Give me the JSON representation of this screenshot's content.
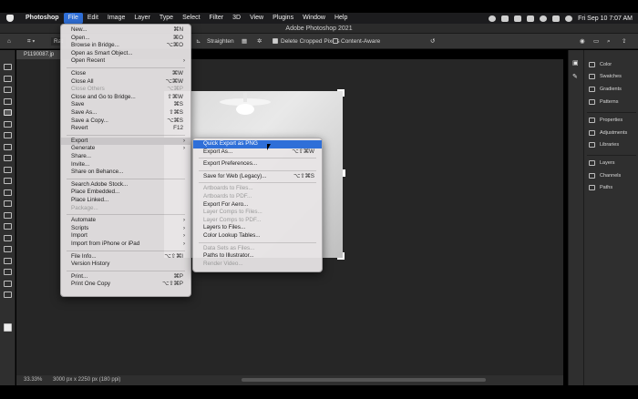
{
  "menubar": {
    "app": "Photoshop",
    "items": [
      "File",
      "Edit",
      "Image",
      "Layer",
      "Type",
      "Select",
      "Filter",
      "3D",
      "View",
      "Plugins",
      "Window",
      "Help"
    ],
    "active": "File",
    "clock": "Fri Sep 10  7:07 AM"
  },
  "window": {
    "title": "Adobe Photoshop 2021"
  },
  "options": {
    "ratio_label": "Rat",
    "straighten": "Straighten",
    "delete_cropped": "Delete Cropped Pixels",
    "content_aware": "Content-Aware"
  },
  "document": {
    "tab": "P1190087.jp"
  },
  "status": {
    "zoom": "33.33%",
    "dimensions": "3000 px x 2250 px (180 ppi)"
  },
  "right_panel": {
    "items": [
      "Color",
      "Swatches",
      "Gradients",
      "Patterns",
      "Properties",
      "Adjustments",
      "Libraries",
      "Layers",
      "Channels",
      "Paths"
    ]
  },
  "file_menu": {
    "rows": [
      {
        "label": "New...",
        "shortcut": "⌘N"
      },
      {
        "label": "Open...",
        "shortcut": "⌘O"
      },
      {
        "label": "Browse in Bridge...",
        "shortcut": "⌥⌘O"
      },
      {
        "label": "Open as Smart Object...",
        "shortcut": ""
      },
      {
        "label": "Open Recent",
        "shortcut": "",
        "submenu": true
      },
      {
        "sep": true
      },
      {
        "label": "Close",
        "shortcut": "⌘W"
      },
      {
        "label": "Close All",
        "shortcut": "⌥⌘W"
      },
      {
        "label": "Close Others",
        "shortcut": "⌥⌘P",
        "disabled": true
      },
      {
        "label": "Close and Go to Bridge...",
        "shortcut": "⇧⌘W"
      },
      {
        "label": "Save",
        "shortcut": "⌘S"
      },
      {
        "label": "Save As...",
        "shortcut": "⇧⌘S"
      },
      {
        "label": "Save a Copy...",
        "shortcut": "⌥⌘S"
      },
      {
        "label": "Revert",
        "shortcut": "F12"
      },
      {
        "sep": true
      },
      {
        "label": "Export",
        "shortcut": "",
        "submenu": true,
        "highlight": true
      },
      {
        "label": "Generate",
        "shortcut": "",
        "submenu": true
      },
      {
        "label": "Share...",
        "shortcut": ""
      },
      {
        "label": "Invite...",
        "shortcut": ""
      },
      {
        "label": "Share on Behance...",
        "shortcut": ""
      },
      {
        "sep": true
      },
      {
        "label": "Search Adobe Stock...",
        "shortcut": ""
      },
      {
        "label": "Place Embedded...",
        "shortcut": ""
      },
      {
        "label": "Place Linked...",
        "shortcut": ""
      },
      {
        "label": "Package...",
        "shortcut": "",
        "disabled": true
      },
      {
        "sep": true
      },
      {
        "label": "Automate",
        "shortcut": "",
        "submenu": true
      },
      {
        "label": "Scripts",
        "shortcut": "",
        "submenu": true
      },
      {
        "label": "Import",
        "shortcut": "",
        "submenu": true
      },
      {
        "label": "Import from iPhone or iPad",
        "shortcut": "",
        "submenu": true
      },
      {
        "sep": true
      },
      {
        "label": "File Info...",
        "shortcut": "⌥⇧⌘I"
      },
      {
        "label": "Version History",
        "shortcut": ""
      },
      {
        "sep": true
      },
      {
        "label": "Print...",
        "shortcut": "⌘P"
      },
      {
        "label": "Print One Copy",
        "shortcut": "⌥⇧⌘P"
      }
    ]
  },
  "export_menu": {
    "rows": [
      {
        "label": "Quick Export as PNG",
        "shortcut": "",
        "selected": true
      },
      {
        "label": "Export As...",
        "shortcut": "⌥⇧⌘W"
      },
      {
        "sep": true
      },
      {
        "label": "Export Preferences...",
        "shortcut": ""
      },
      {
        "sep": true
      },
      {
        "label": "Save for Web (Legacy)...",
        "shortcut": "⌥⇧⌘S"
      },
      {
        "sep": true
      },
      {
        "label": "Artboards to Files...",
        "shortcut": "",
        "disabled": true
      },
      {
        "label": "Artboards to PDF...",
        "shortcut": "",
        "disabled": true
      },
      {
        "label": "Export For Aero...",
        "shortcut": ""
      },
      {
        "label": "Layer Comps to Files...",
        "shortcut": "",
        "disabled": true
      },
      {
        "label": "Layer Comps to PDF...",
        "shortcut": "",
        "disabled": true
      },
      {
        "label": "Layers to Files...",
        "shortcut": ""
      },
      {
        "label": "Color Lookup Tables...",
        "shortcut": ""
      },
      {
        "sep": true
      },
      {
        "label": "Data Sets as Files...",
        "shortcut": "",
        "disabled": true
      },
      {
        "label": "Paths to Illustrator...",
        "shortcut": ""
      },
      {
        "label": "Render Video...",
        "shortcut": "",
        "disabled": true
      }
    ]
  }
}
